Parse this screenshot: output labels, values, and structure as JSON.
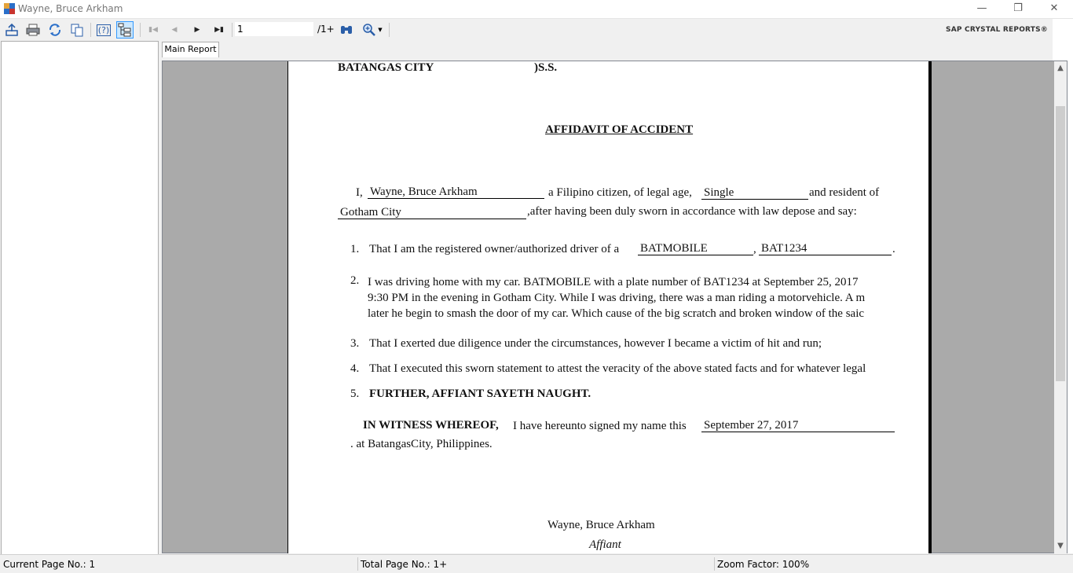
{
  "window": {
    "title": "Wayne, Bruce Arkham"
  },
  "toolbar": {
    "current_page": "1",
    "page_of": "/1+",
    "brand": "SAP CRYSTAL REPORTS®",
    "help_label": "(?)"
  },
  "tabs": [
    {
      "label": "Main Report"
    }
  ],
  "report": {
    "venue_place": "BATANGAS CITY",
    "venue_ss": ")S.S.",
    "title": "AFFIDAVIT OF ACCIDENT",
    "intro_prefix": "I,",
    "affiant_name": "Wayne, Bruce Arkham",
    "intro_mid": "a Filipino citizen, of legal age,",
    "civil_status": "Single",
    "intro_end": "and resident of",
    "residence": "Gotham City",
    "intro_tail": ",after having been duly sworn in accordance with law depose and say:",
    "item1_num": "1.",
    "item1_text": "That I am the registered owner/authorized driver of a",
    "vehicle": "BATMOBILE",
    "comma": ",",
    "plate": "BAT1234",
    "period": ".",
    "item2_num": "2.",
    "item2_line1": "I was driving home with my  car. BATMOBILE with a plate number of BAT1234  at September 25, 2017",
    "item2_line2": "9:30 PM in the evening in Gotham City. While I was driving, there was a man riding a motorvehicle. A m",
    "item2_line3": "later he begin to smash the door of my car. Which cause of the big scratch and broken window of the saic",
    "item3_num": "3.",
    "item3_text": "That I exerted due diligence under the circumstances, however I became a victim of hit and run;",
    "item4_num": "4.",
    "item4_text": "That I executed this sworn statement to attest the veracity of the above stated facts and for whatever legal",
    "item5_num": "5.",
    "item5_text": "FURTHER, AFFIANT SAYETH NAUGHT.",
    "witness_bold": "IN WITNESS WHEREOF,",
    "witness_text": "I have hereunto signed my name this",
    "sign_date": "September 27, 2017",
    "location_line": ". at BatangasCity, Philippines.",
    "signature_name": "Wayne, Bruce Arkham",
    "signature_role": "Affiant"
  },
  "status": {
    "current_page": "Current Page No.: 1",
    "total_page": "Total Page No.: 1+",
    "zoom": "Zoom Factor: 100%"
  }
}
